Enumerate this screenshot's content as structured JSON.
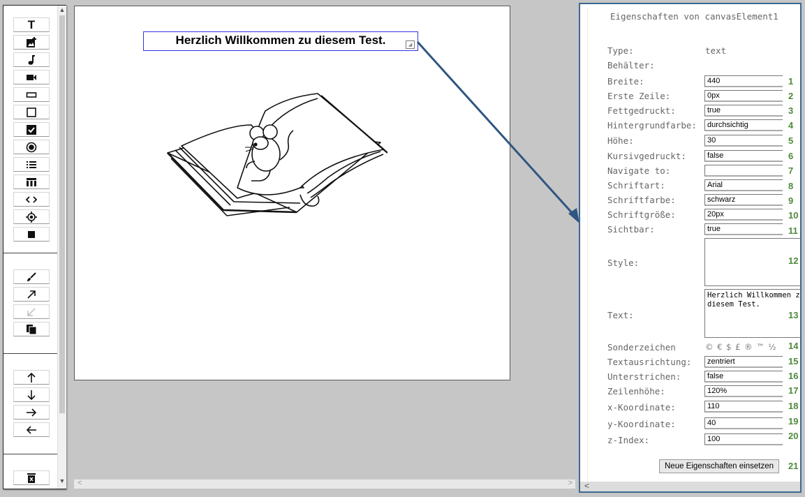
{
  "canvas": {
    "element_text": "Herzlich Willkommen zu diesem Test."
  },
  "panel": {
    "title": "Eigenschaften von canvasElement1",
    "type_label": "Type:",
    "type_value": "text",
    "container_label": "Behälter:",
    "properties": [
      {
        "label": "Breite:",
        "value": "440",
        "num": "1"
      },
      {
        "label": "Erste Zeile:",
        "value": "0px",
        "num": "2"
      },
      {
        "label": "Fettgedruckt:",
        "value": "true",
        "num": "3"
      },
      {
        "label": "Hintergrundfarbe:",
        "value": "durchsichtig",
        "num": "4"
      },
      {
        "label": "Höhe:",
        "value": "30",
        "num": "5"
      },
      {
        "label": "Kursivgedruckt:",
        "value": "false",
        "num": "6"
      },
      {
        "label": "Navigate to:",
        "value": "",
        "num": "7"
      },
      {
        "label": "Schriftart:",
        "value": "Arial",
        "num": "8"
      },
      {
        "label": "Schriftfarbe:",
        "value": "schwarz",
        "num": "9"
      },
      {
        "label": "Schriftgröße:",
        "value": "20px",
        "num": "10"
      },
      {
        "label": "Sichtbar:",
        "value": "true",
        "num": "11"
      }
    ],
    "style_label": "Style:",
    "style_value": "",
    "style_num": "12",
    "text_label": "Text:",
    "text_value": "Herzlich Willkommen zu diesem Test.",
    "text_num": "13",
    "special_label": "Sonderzeichen",
    "special_chars": "© € $ £ ® ™ ½",
    "special_num": "14",
    "properties2": [
      {
        "label": "Textausrichtung:",
        "value": "zentriert",
        "num": "15"
      },
      {
        "label": "Unterstrichen:",
        "value": "false",
        "num": "16"
      },
      {
        "label": "Zeilenhöhe:",
        "value": "120%",
        "num": "17"
      },
      {
        "label": "x-Koordinate:",
        "value": "110",
        "num": "18"
      },
      {
        "label": "y-Koordinate:",
        "value": "40",
        "num": "19"
      },
      {
        "label": "z-Index:",
        "value": "100",
        "num": "20"
      }
    ],
    "apply_button": "Neue Eigenschaften einsetzen",
    "apply_num": "21"
  },
  "toolbar": {
    "icons": [
      "text-tool-icon",
      "add-image-icon",
      "music-note-icon",
      "video-camera-icon",
      "button-tool-icon",
      "square-tool-icon",
      "checkbox-tool-icon",
      "radio-tool-icon",
      "list-tool-icon",
      "table-tool-icon",
      "code-tool-icon",
      "target-tool-icon",
      "stop-icon",
      "brush-icon",
      "arrow-up-right-icon",
      "arrow-down-left-icon",
      "copy-icon",
      "arrow-up-icon",
      "arrow-down-icon",
      "arrow-right-icon",
      "arrow-left-icon",
      "delete-icon"
    ]
  },
  "colors": {
    "accent_border": "#3c6a94",
    "number_green": "#4e8a3a",
    "selection_blue": "#3434e0"
  }
}
